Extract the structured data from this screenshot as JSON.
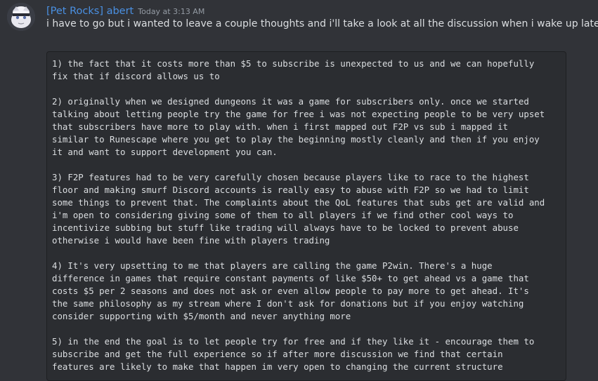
{
  "message": {
    "author": "[Pet Rocks] abert",
    "timestamp": "Today at 3:13 AM",
    "text": "i have to go but i wanted to leave a couple thoughts and i'll take a look at all the discussion when i wake up later",
    "avatar_icon": "avatar-icon",
    "code_paragraphs": [
      "1) the fact that it costs more than $5 to subscribe is unexpected to us and we can hopefully\nfix that if discord allows us to",
      "2) originally when we designed dungeons it was a game for subscribers only. once we started\ntalking about letting people try the game for free i was not expecting people to be very upset\nthat subscribers have more to play with. when i first mapped out F2P vs sub i mapped it\nsimilar to Runescape where you get to play the beginning mostly cleanly and then if you enjoy\nit and want to support development you can.",
      "3) F2P features had to be very carefully chosen because players like to race to the highest\nfloor and making smurf Discord accounts is really easy to abuse with F2P so we had to limit\nsome things to prevent that. The complaints about the QoL features that subs get are valid and\ni'm open to considering giving some of them to all players if we find other cool ways to\nincentivize subbing but stuff like trading will always have to be locked to prevent abuse\notherwise i would have been fine with players trading",
      "4) It's very upsetting to me that players are calling the game P2win. There's a huge\ndifference in games that require constant payments of like $50+ to get ahead vs a game that\ncosts $5 per 2 seasons and does not ask or even allow people to pay more to get ahead. It's\nthe same philosophy as my stream where I don't ask for donations but if you enjoy watching\nconsider supporting with $5/month and never anything more",
      "5) in the end the goal is to let people try for free and if they like it - encourage them to\nsubscribe and get the full experience so if after more discussion we find that certain\nfeatures are likely to make that happen im very open to changing the current structure"
    ]
  },
  "colors": {
    "background": "#313338",
    "username": "#4a90e2",
    "timestamp": "#949ba4",
    "text": "#dbdee1",
    "codeblock_bg": "#2b2d31",
    "codeblock_border": "#1e1f22"
  }
}
